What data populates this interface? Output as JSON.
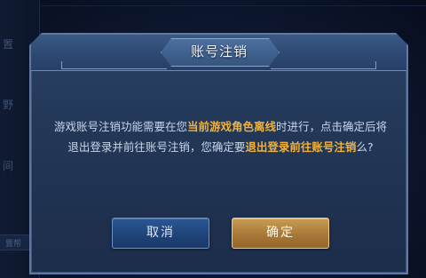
{
  "background": {
    "side_chars": [
      "置",
      "野",
      "间"
    ],
    "field_text": "置帮"
  },
  "dialog": {
    "title": "账号注销",
    "message": {
      "part1": "游戏账号注销功能需要在您",
      "highlight1": "当前游戏角色离线",
      "part2": "时进行，点击确定后将退出登录并前往账号注销，您确定要",
      "highlight2": "退出登录前往账号注销",
      "part3": "么?"
    },
    "cancel_label": "取消",
    "confirm_label": "确定"
  },
  "colors": {
    "highlight": "#f0b23a",
    "panel": "#223656",
    "confirm_button": "#a87838",
    "cancel_button": "#1f447a"
  }
}
